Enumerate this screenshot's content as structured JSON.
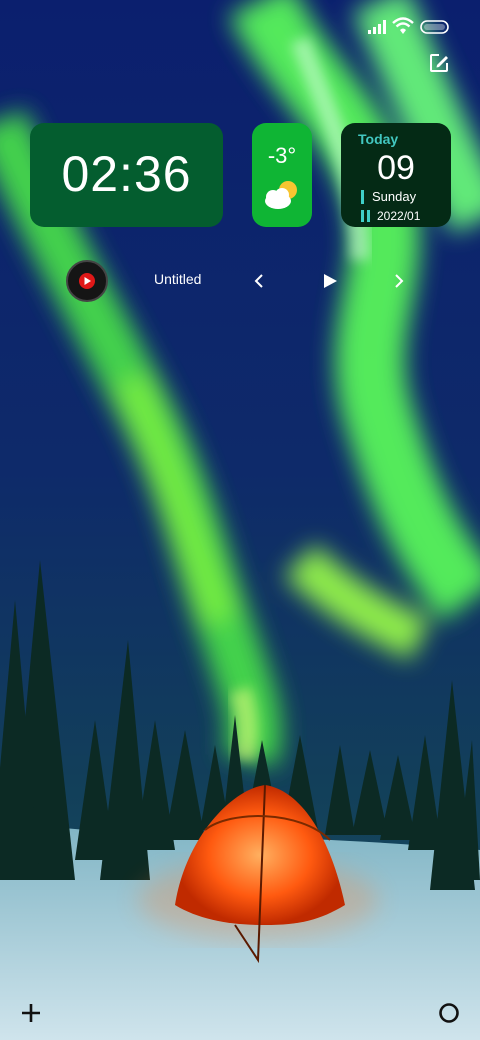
{
  "colors": {
    "clock_widget_bg": "#045d2f",
    "weather_widget_bg": "#0fb534",
    "date_widget_bg": "#042a15",
    "date_accent": "#42c7c0",
    "aurora": "#5bff5a",
    "tent": "#ff5a10"
  },
  "status_bar": {
    "icons": [
      "signal-icon",
      "wifi-icon",
      "battery-icon"
    ]
  },
  "clock_widget": {
    "time": "02:36"
  },
  "weather_widget": {
    "temperature": "-3°",
    "icon": "partly-cloudy-icon"
  },
  "date_widget": {
    "today_label": "Today",
    "day": "09",
    "weekday": "Sunday",
    "year_month": "2022/01"
  },
  "music_widget": {
    "title": "Untitled",
    "icons": [
      "music-app-icon",
      "previous-icon",
      "play-icon",
      "next-icon"
    ]
  },
  "dock": {
    "icons": [
      "add-icon",
      "home-circle-icon"
    ]
  },
  "wallpaper": {
    "subject": "aurora-over-tent"
  }
}
